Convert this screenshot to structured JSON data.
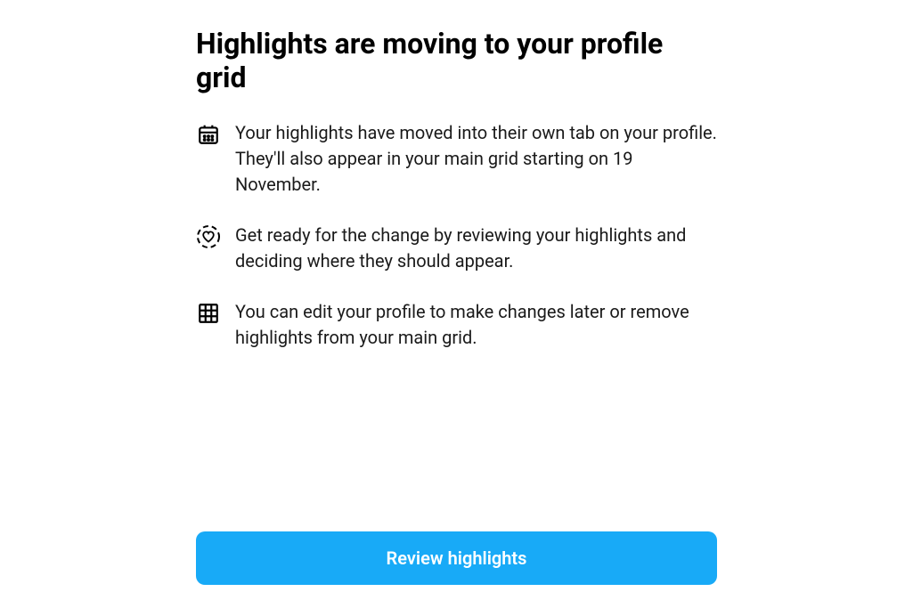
{
  "title": "Highlights are moving to your profile grid",
  "items": [
    {
      "text": "Your highlights have moved into their own tab on your profile. They'll also appear in your main grid starting on 19 November."
    },
    {
      "text": "Get ready for the change by reviewing your highlights and deciding where they should appear."
    },
    {
      "text": "You can edit your profile to make changes later or remove highlights from your main grid."
    }
  ],
  "button": {
    "label": "Review highlights"
  }
}
